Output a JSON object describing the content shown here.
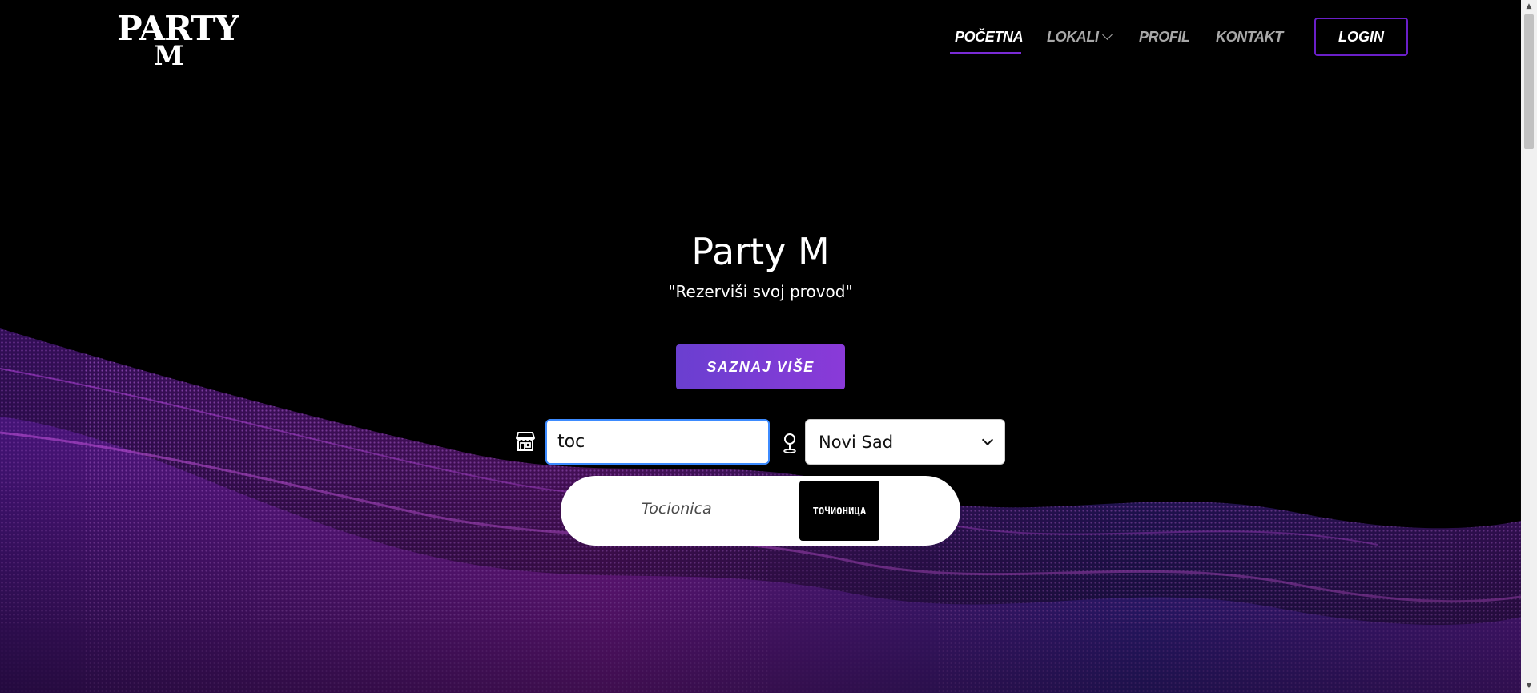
{
  "header": {
    "logo_top": "PARTY",
    "logo_bottom": "M",
    "nav": [
      {
        "label": "POČETNA",
        "active": true
      },
      {
        "label": "LOKALI",
        "has_dropdown": true
      },
      {
        "label": "PROFIL"
      },
      {
        "label": "KONTAKT"
      }
    ],
    "login_label": "LOGIN"
  },
  "hero": {
    "title": "Party M",
    "subtitle": "\"Rezerviši svoj provod\"",
    "cta_label": "SAZNAJ VIŠE"
  },
  "search": {
    "query": "toc",
    "store_icon": "store-icon",
    "location_icon": "map-pin-icon",
    "city_selected": "Novi Sad"
  },
  "results": [
    {
      "name": "Tocionica",
      "thumb_text": "ТОЧИОНИЦА"
    }
  ],
  "colors": {
    "accent": "#7a2bd6",
    "cta_gradient_start": "#6a3fd0",
    "cta_gradient_end": "#8a3ad8",
    "input_focus": "#3d8bff",
    "background": "#000000"
  }
}
